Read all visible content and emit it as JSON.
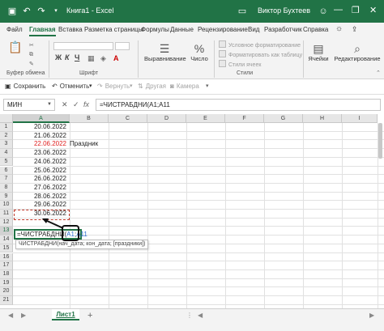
{
  "titlebar": {
    "save_icon": "save-icon",
    "undo_icon": "undo-icon",
    "redo_icon": "redo-icon",
    "title": "Книга1 - Excel",
    "user": "Виктор Бухтеев",
    "minimize_glyph": "—",
    "restore_glyph": "❐",
    "close_glyph": "✕"
  },
  "ribbon_tabs": [
    "Файл",
    "Главная",
    "Вставка",
    "Разметка страницы",
    "Формулы",
    "Данные",
    "Рецензирование",
    "Вид",
    "Разработчик",
    "Справка"
  ],
  "ribbon": {
    "clipboard_label": "Буфер обмена",
    "font_label": "Шрифт",
    "bold": "Ж",
    "italic": "К",
    "underline": "Ч",
    "alignment": "Выравнивание",
    "number": "Число",
    "conditional_formatting": "Условное форматирование",
    "format_as_table": "Форматировать как таблицу",
    "cell_styles": "Стили ячеек",
    "styles_label": "Стили",
    "cells": "Ячейки",
    "editing": "Редактирование"
  },
  "quick_access": {
    "save": "Сохранить",
    "undo": "Отменить",
    "redo": "Вернуть",
    "sort": "Другая",
    "camera": "Камера"
  },
  "formula_bar": {
    "name_box": "МИН",
    "cancel_glyph": "✕",
    "enter_glyph": "✓",
    "fx": "fx",
    "formula": "=ЧИСТРАБДНИ(A1;A11"
  },
  "columns": [
    "A",
    "B",
    "C",
    "D",
    "E",
    "F",
    "G",
    "H",
    "I"
  ],
  "rows": [
    "1",
    "2",
    "3",
    "4",
    "5",
    "6",
    "7",
    "8",
    "9",
    "10",
    "11",
    "12",
    "13",
    "14",
    "15",
    "16",
    "17",
    "18",
    "19",
    "20",
    "21"
  ],
  "cells": {
    "a1": "20.06.2022",
    "a2": "21.06.2022",
    "a3": "22.06.2022",
    "b3": "Праздник",
    "a4": "23.06.2022",
    "a5": "24.06.2022",
    "a6": "25.06.2022",
    "a7": "26.06.2022",
    "a8": "27.06.2022",
    "a9": "28.06.2022",
    "a10": "29.06.2022",
    "a11": "30.06.2022",
    "a13_prefix": "=ЧИСТРАБДНИ(",
    "a13_ref1": "A1",
    "a13_sep": ";",
    "a13_ref2": "A11"
  },
  "tooltip": "ЧИСТРАБДНИ(нач_дата; кон_дата; [праздники])",
  "sheet_tab": "Лист1",
  "add_sheet": "+",
  "colors": {
    "accent": "#217346",
    "holiday": "#e02020",
    "marquee": "#c0392b"
  }
}
